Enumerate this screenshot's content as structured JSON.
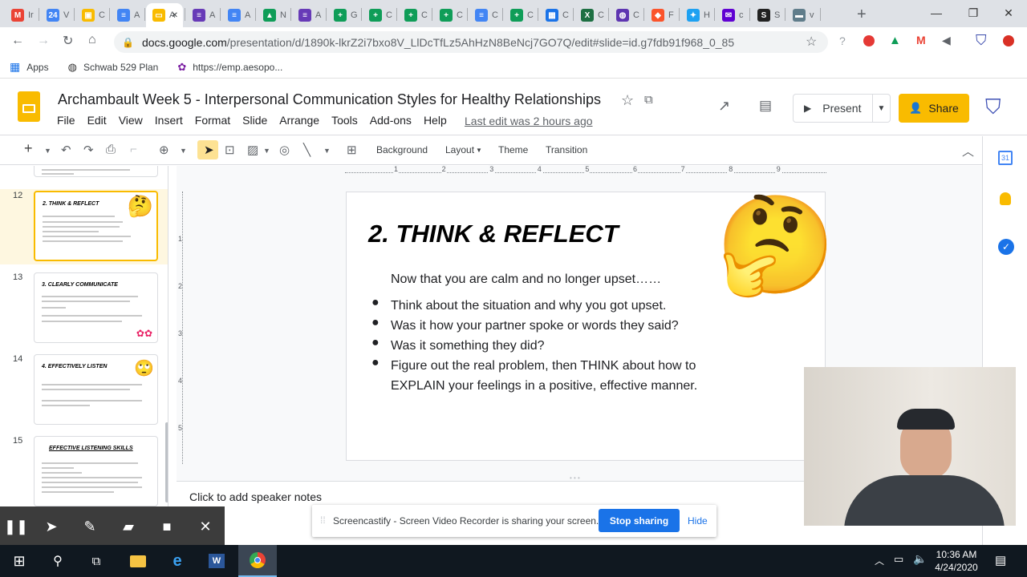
{
  "browser": {
    "tabs": [
      {
        "icon": "gmail-icon",
        "label": "Ir",
        "color": "#ea4335",
        "glyph": "M"
      },
      {
        "icon": "calendar-icon",
        "label": "V",
        "color": "#4285f4",
        "glyph": "24"
      },
      {
        "icon": "classroom-icon",
        "label": "C",
        "color": "#f9bb00",
        "glyph": "▣"
      },
      {
        "icon": "docs-icon",
        "label": "A",
        "color": "#4285f4",
        "glyph": "≡"
      },
      {
        "icon": "slides-icon",
        "label": "A",
        "color": "#f9bb00",
        "glyph": "▭",
        "active": true
      },
      {
        "icon": "forms-icon",
        "label": "A",
        "color": "#673ab7",
        "glyph": "≡"
      },
      {
        "icon": "docs-icon",
        "label": "A",
        "color": "#4285f4",
        "glyph": "≡"
      },
      {
        "icon": "drive-icon",
        "label": "N",
        "color": "#0f9d58",
        "glyph": "▲"
      },
      {
        "icon": "forms-icon",
        "label": "A",
        "color": "#673ab7",
        "glyph": "≡"
      },
      {
        "icon": "sheets-icon",
        "label": "G",
        "color": "#0f9d58",
        "glyph": "+"
      },
      {
        "icon": "sheets-icon",
        "label": "C",
        "color": "#0f9d58",
        "glyph": "+"
      },
      {
        "icon": "sheets-icon",
        "label": "C",
        "color": "#0f9d58",
        "glyph": "+"
      },
      {
        "icon": "sheets-icon",
        "label": "C",
        "color": "#0f9d58",
        "glyph": "+"
      },
      {
        "icon": "docs-icon",
        "label": "C",
        "color": "#4285f4",
        "glyph": "≡"
      },
      {
        "icon": "sheets-icon",
        "label": "C",
        "color": "#0f9d58",
        "glyph": "+"
      },
      {
        "icon": "site-icon",
        "label": "C",
        "color": "#1a73e8",
        "glyph": "▦"
      },
      {
        "icon": "excel-icon",
        "label": "C",
        "color": "#1d6f42",
        "glyph": "X"
      },
      {
        "icon": "globe-icon",
        "label": "C",
        "color": "#5e35b1",
        "glyph": "◍"
      },
      {
        "icon": "brave-icon",
        "label": "F",
        "color": "#fb542b",
        "glyph": "◆"
      },
      {
        "icon": "twitter-icon",
        "label": "H",
        "color": "#1da1f2",
        "glyph": "✦"
      },
      {
        "icon": "mail-icon",
        "label": "c",
        "color": "#6001d2",
        "glyph": "✉"
      },
      {
        "icon": "schwab-icon",
        "label": "S",
        "color": "#222222",
        "glyph": "S"
      },
      {
        "icon": "site-icon",
        "label": "v",
        "color": "#607d8b",
        "glyph": "▬"
      }
    ],
    "url_domain": "docs.google.com",
    "url_path": "/presentation/d/1890k-lkrZ2i7bxo8V_LlDcTfLz5AhHzN8BeNcj7GO7Q/edit#slide=id.g7fdb91f968_0_85",
    "bookmarks": [
      {
        "label": "Apps",
        "icon": "apps-grid-icon"
      },
      {
        "label": "Schwab 529 Plan",
        "icon": "bookmark-site-icon"
      },
      {
        "label": "https://emp.aesopo...",
        "icon": "aesop-icon"
      }
    ]
  },
  "slides_app": {
    "doc_title": "Archambault Week 5 - Interpersonal Communication Styles for Healthy Relationships",
    "menu": [
      "File",
      "Edit",
      "View",
      "Insert",
      "Format",
      "Slide",
      "Arrange",
      "Tools",
      "Add-ons",
      "Help"
    ],
    "last_edit": "Last edit was 2 hours ago",
    "present_label": "Present",
    "share_label": "Share",
    "toolbar_text": [
      "Background",
      "Layout",
      "Theme",
      "Transition"
    ],
    "speaker_notes_placeholder": "Click to add speaker notes"
  },
  "filmstrip": {
    "slides": [
      {
        "number": "12",
        "title": "2. THINK & REFLECT",
        "selected": true,
        "emoji": "🤔"
      },
      {
        "number": "13",
        "title": "3. CLEARLY COMMUNICATE",
        "selected": false,
        "emoji": ""
      },
      {
        "number": "14",
        "title": "4. EFFECTIVELY LISTEN",
        "selected": false,
        "emoji": "🙄"
      },
      {
        "number": "15",
        "title": "EFFECTIVE LISTENING SKILLS",
        "selected": false,
        "emoji": ""
      }
    ]
  },
  "slide": {
    "title": "2. THINK & REFLECT",
    "intro": "Now that you are calm and no longer upset……",
    "bullets": [
      "Think about the situation and why you got upset.",
      "Was it how your partner spoke or words they said?",
      "Was it something they did?",
      "Figure out the real problem, then THINK about how to EXPLAIN your feelings in a positive, effective manner."
    ],
    "emoji": "🤔"
  },
  "ruler": [
    "1",
    "2",
    "3",
    "4",
    "5",
    "6",
    "7",
    "8",
    "9"
  ],
  "screencastify": {
    "message": "Screencastify - Screen Video Recorder is sharing your screen.",
    "stop_label": "Stop sharing",
    "hide_label": "Hide"
  },
  "taskbar": {
    "time": "10:36 AM",
    "date": "4/24/2020"
  },
  "colors": {
    "accent": "#f9bb00",
    "link_blue": "#1a73e8"
  }
}
